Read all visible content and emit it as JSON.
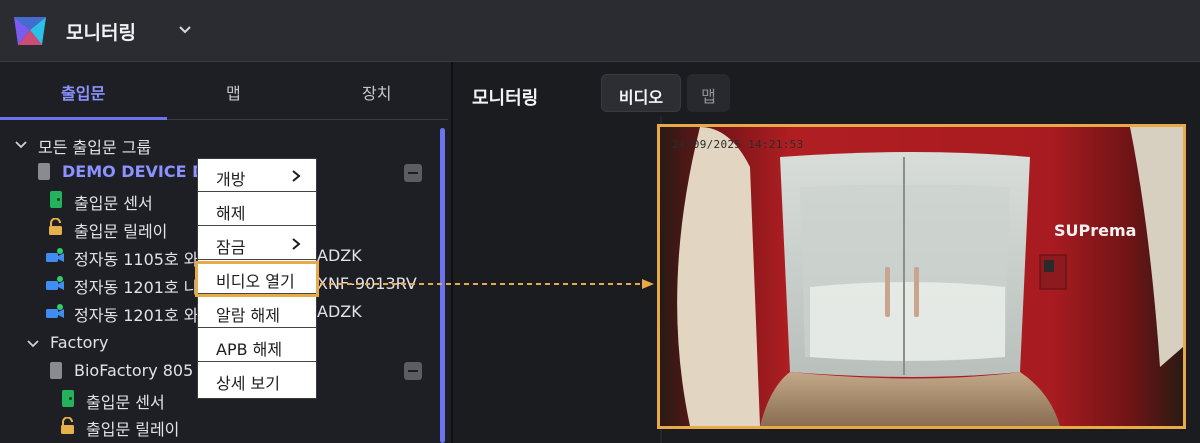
{
  "topbar": {
    "title": "모니터링"
  },
  "sidebar": {
    "tabs": [
      {
        "label": "출입문"
      },
      {
        "label": "맵"
      },
      {
        "label": "장치"
      }
    ],
    "tree": {
      "group_root": "모든 출입문 그룹",
      "device1": "DEMO DEVICE DO",
      "device1_sensor": "출입문 센서",
      "device1_relay": "출입문 릴레이",
      "cam1_prefix": "정자동 1105호 와",
      "cam1_suffix": "ADZK",
      "cam2_prefix": "정자동 1201호 나",
      "cam2_suffix": "XNF-9013RV",
      "cam3_prefix": "정자동 1201호 와",
      "cam3_suffix": "ADZK",
      "group2": "Factory",
      "device2": "BioFactory 805",
      "device2_sensor": "출입문 센서",
      "device2_relay": "출입문 릴레이"
    }
  },
  "context_menu": {
    "items": [
      {
        "label": "개방"
      },
      {
        "label": "해제"
      },
      {
        "label": "잠금"
      },
      {
        "label": "비디오 열기"
      },
      {
        "label": "알람 해제"
      },
      {
        "label": "APB 해제"
      },
      {
        "label": "상세 보기"
      }
    ]
  },
  "main": {
    "title": "모니터링",
    "view_tabs": [
      {
        "label": "비디오"
      },
      {
        "label": "맵"
      }
    ]
  },
  "video": {
    "timestamp": "24/09/2025 14:21:53",
    "brand": "SUPrema"
  },
  "colors": {
    "accent": "#6d73ee",
    "highlight": "#e8a948",
    "sensor": "#22b35c"
  }
}
